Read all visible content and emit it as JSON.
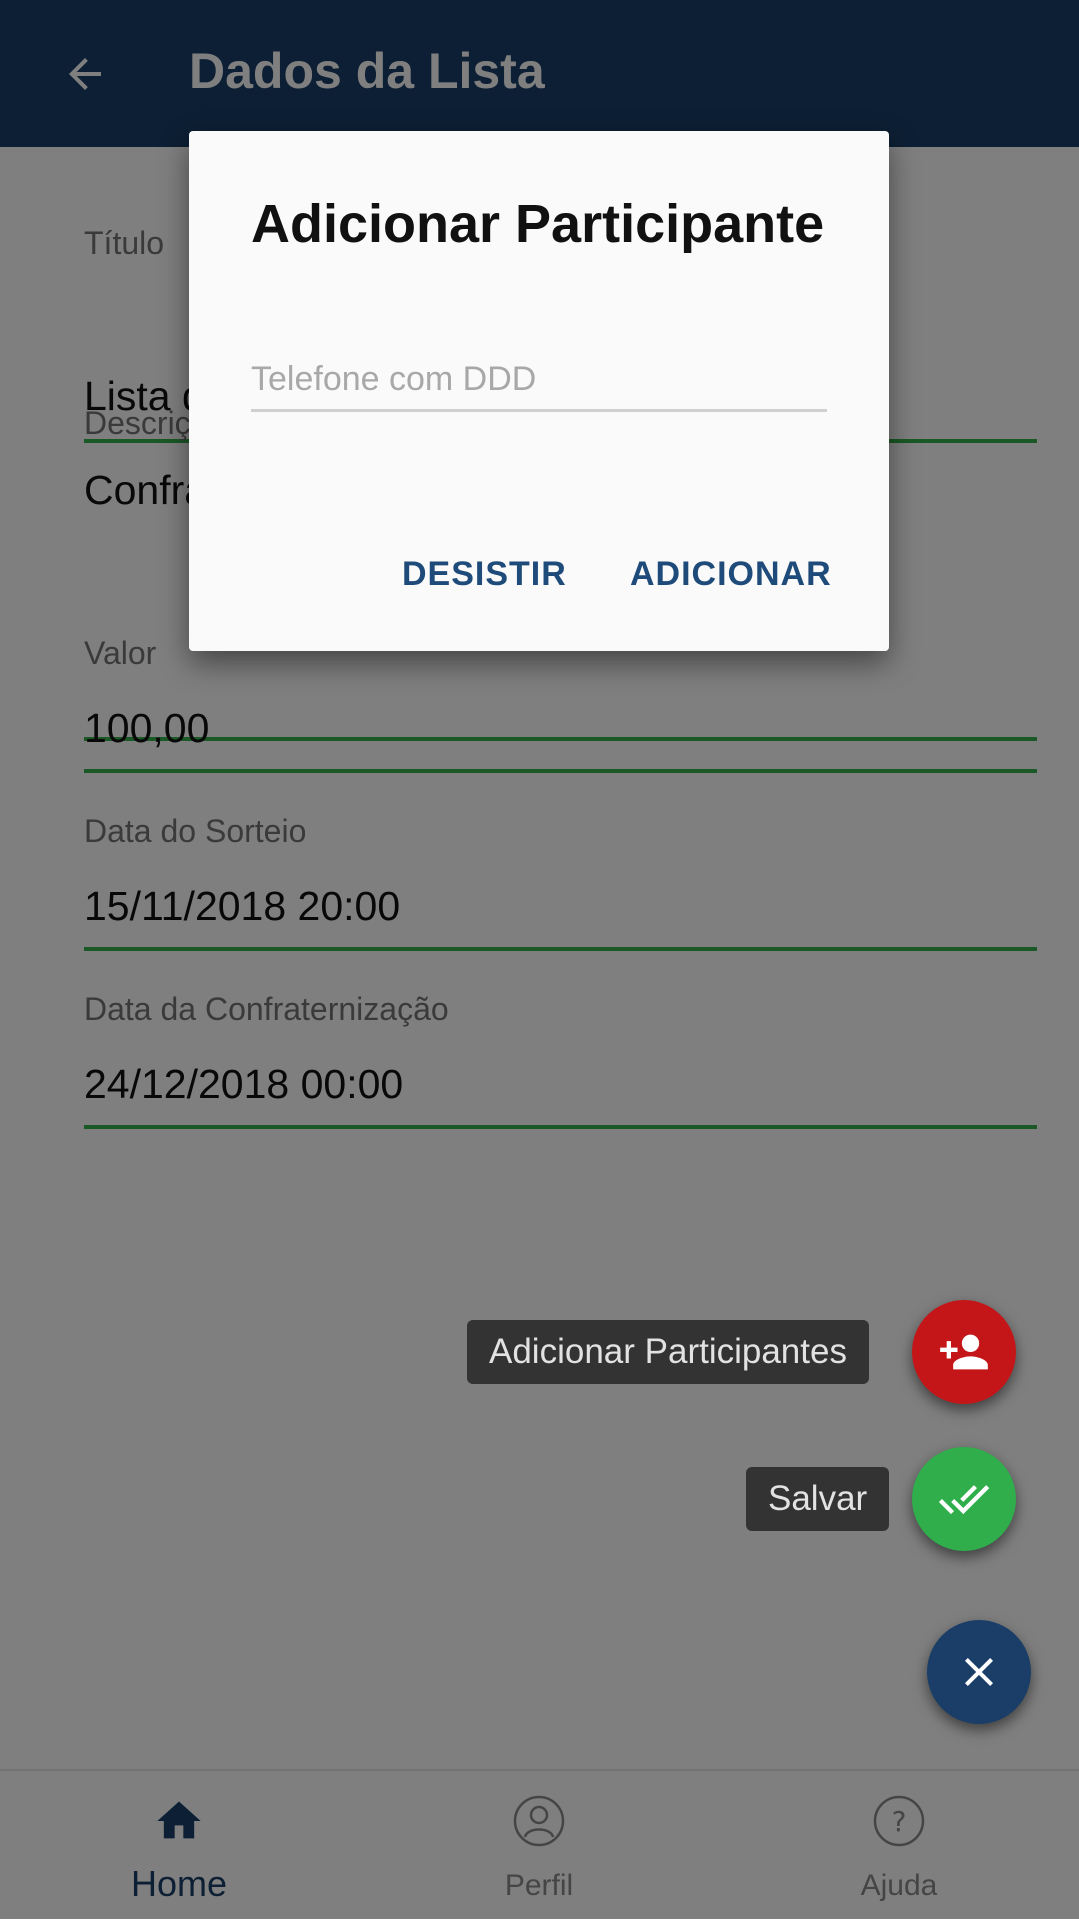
{
  "appbar": {
    "title": "Dados da Lista",
    "back_icon": "arrow-back-icon"
  },
  "form": {
    "fields": [
      {
        "label": "Título",
        "value": "Lista d"
      },
      {
        "label": "Descriç",
        "value": "Confra"
      },
      {
        "label": "Valor",
        "value": "100,00"
      },
      {
        "label": "Data do Sorteio",
        "value": "15/11/2018 20:00"
      },
      {
        "label": "Data da Confraternização",
        "value": "24/12/2018 00:00"
      }
    ]
  },
  "dialog": {
    "title": "Adicionar Participante",
    "phone_placeholder": "Telefone com DDD",
    "phone_value": "",
    "cancel_label": "DESISTIR",
    "confirm_label": "ADICIONAR"
  },
  "fab_menu": {
    "add_participants_label": "Adicionar Participantes",
    "add_participants_icon": "person-add-icon",
    "save_label": "Salvar",
    "save_icon": "double-check-icon",
    "close_icon": "close-icon"
  },
  "bottom_nav": {
    "items": [
      {
        "label": "Home",
        "icon": "home-icon",
        "active": true
      },
      {
        "label": "Perfil",
        "icon": "profile-icon",
        "active": false
      },
      {
        "label": "Ajuda",
        "icon": "help-icon",
        "active": false
      }
    ]
  },
  "colors": {
    "appbar": "#1a3e68",
    "field_underline": "#34b24a",
    "add_participant_fab": "#c41618",
    "save_fab": "#2fae4b",
    "close_fab": "#1a3e68",
    "nav_active": "#1a3e68",
    "nav_inactive": "#8a8a8a",
    "dialog_button": "#1f4b7a"
  }
}
